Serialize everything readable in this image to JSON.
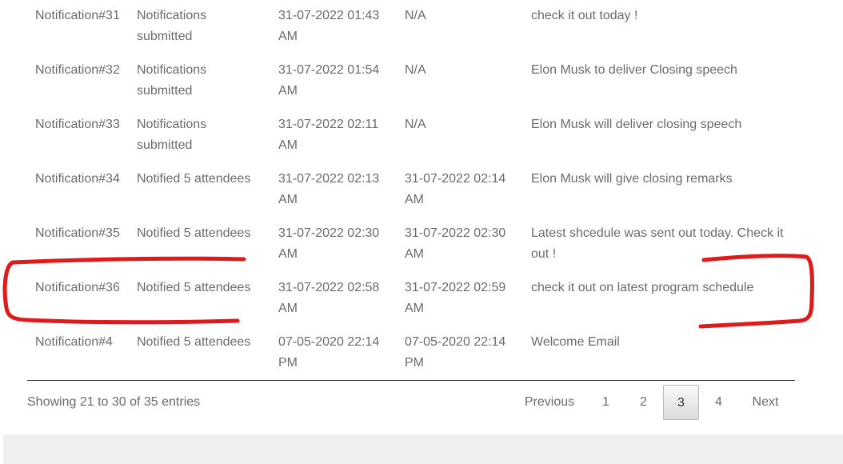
{
  "table": {
    "rows": [
      {
        "id": "Notification#31",
        "status": "Notifications submitted",
        "created": "31-07-2022 01:43 AM",
        "sent": "N/A",
        "message": "check it out today !"
      },
      {
        "id": "Notification#32",
        "status": "Notifications submitted",
        "created": "31-07-2022 01:54 AM",
        "sent": "N/A",
        "message": "Elon Musk to deliver Closing speech"
      },
      {
        "id": "Notification#33",
        "status": "Notifications submitted",
        "created": "31-07-2022 02:11 AM",
        "sent": "N/A",
        "message": "Elon Musk will deliver closing speech"
      },
      {
        "id": "Notification#34",
        "status": "Notified 5 attendees",
        "created": "31-07-2022 02:13 AM",
        "sent": "31-07-2022 02:14 AM",
        "message": "Elon Musk will give closing remarks"
      },
      {
        "id": "Notification#35",
        "status": "Notified 5 attendees",
        "created": "31-07-2022 02:30 AM",
        "sent": "31-07-2022 02:30 AM",
        "message": "Latest shcedule was sent out today. Check it out !"
      },
      {
        "id": "Notification#36",
        "status": "Notified 5 attendees",
        "created": "31-07-2022 02:58 AM",
        "sent": "31-07-2022 02:59 AM",
        "message": "check it out on latest program schedule"
      },
      {
        "id": "Notification#4",
        "status": "Notified 5 attendees",
        "created": "07-05-2020 22:14 PM",
        "sent": "07-05-2020 22:14 PM",
        "message": "Welcome Email"
      }
    ]
  },
  "footer": {
    "info": "Showing 21 to 30 of 35 entries"
  },
  "pagination": {
    "previous": "Previous",
    "pages": [
      "1",
      "2",
      "3",
      "4"
    ],
    "current": "3",
    "next": "Next"
  },
  "annotation": {
    "color": "#e0191b"
  }
}
